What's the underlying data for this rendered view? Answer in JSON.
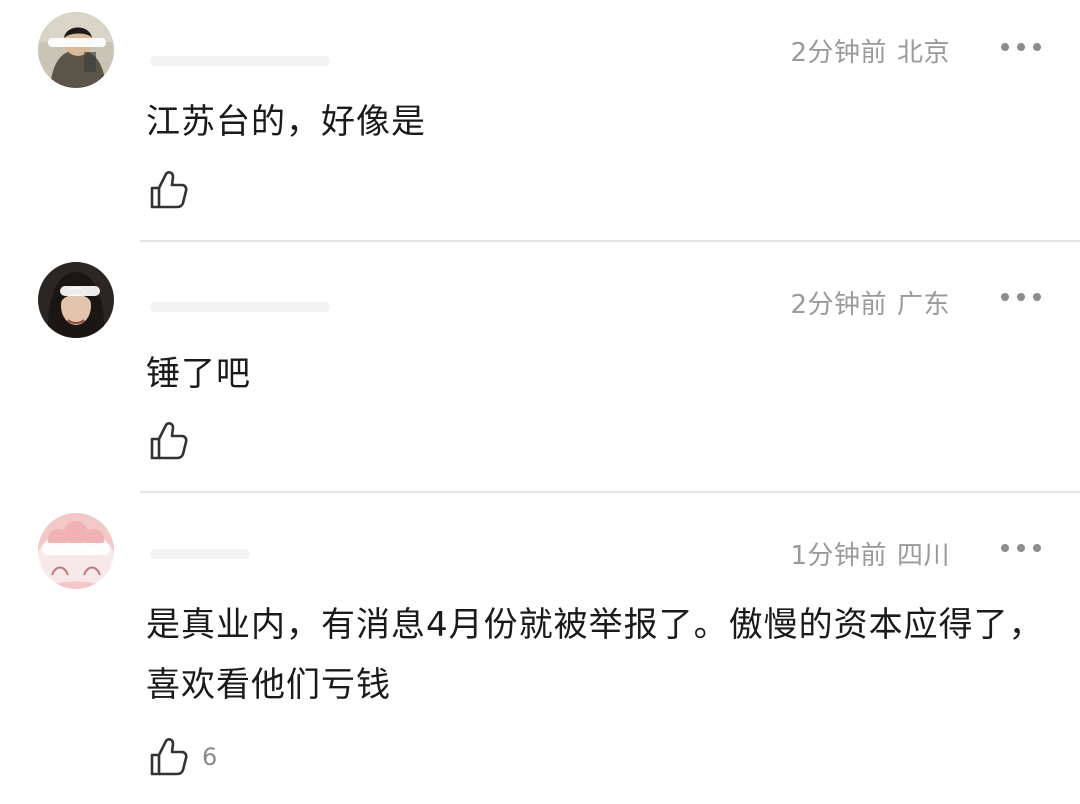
{
  "comments": [
    {
      "time": "2分钟前",
      "location": "北京",
      "content": "江苏台的，好像是",
      "likes": "",
      "avatar_icon": "avatar-photo-man"
    },
    {
      "time": "2分钟前",
      "location": "广东",
      "content": "锤了吧",
      "likes": "",
      "avatar_icon": "avatar-photo-woman"
    },
    {
      "time": "1分钟前",
      "location": "四川",
      "content": "是真业内，有消息4月份就被举报了。傲慢的资本应得了，喜欢看他们亏钱",
      "likes": "6",
      "avatar_icon": "avatar-cartoon-pink"
    }
  ],
  "icons": {
    "more": "more-dots-icon",
    "like": "thumbs-up-icon"
  },
  "colors": {
    "meta_text": "#9a9a9a",
    "content_text": "#1a1a1a",
    "divider": "#e6e6e6",
    "icon": "#333333"
  }
}
